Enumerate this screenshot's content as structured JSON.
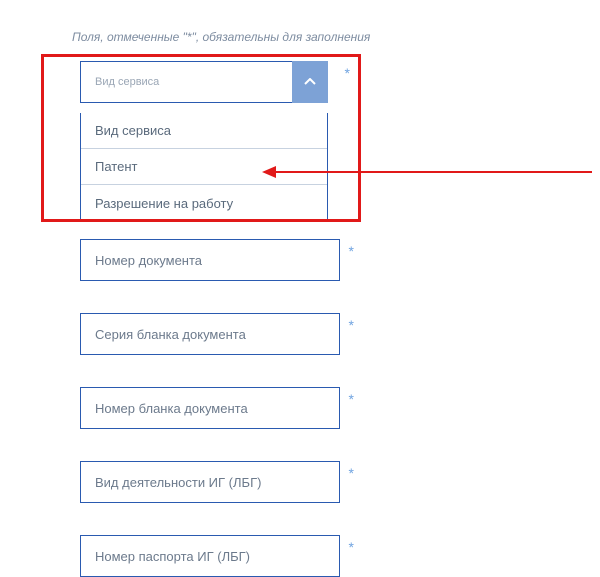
{
  "note": "Поля, отмеченные \"*\", обязательны для заполнения",
  "required_mark": "*",
  "dropdown": {
    "label": "Вид сервиса",
    "options": [
      "Вид сервиса",
      "Патент",
      "Разрешение на работу"
    ]
  },
  "fields": {
    "doc_number": "Номер документа",
    "blank_series": "Серия бланка документа",
    "blank_number": "Номер бланка документа",
    "activity": "Вид деятельности ИГ (ЛБГ)",
    "passport": "Номер паспорта ИГ (ЛБГ)"
  }
}
